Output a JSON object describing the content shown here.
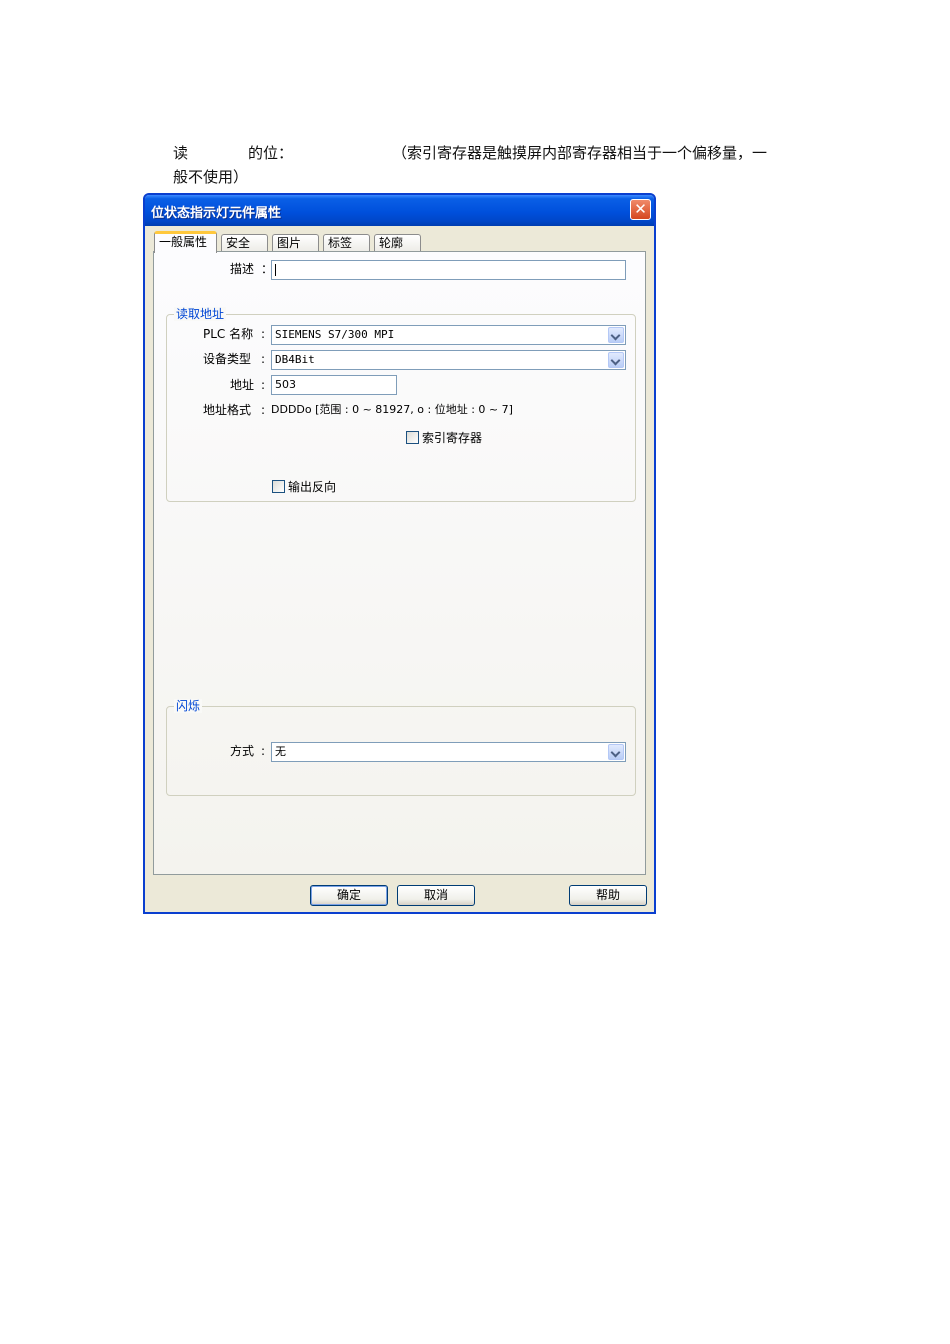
{
  "doc": {
    "line1_word1": "读",
    "line1_word2": "的位：",
    "line1_note": "（索引寄存器是触摸屏内部寄存器相当于一个偏移量，一",
    "line2": "般不使用）"
  },
  "dialog": {
    "title": "位状态指示灯元件属性",
    "close_glyph": "✕",
    "tabs": [
      "一般属性",
      "安全",
      "图片",
      "标签",
      "轮廓"
    ],
    "description": {
      "label": "描述",
      "colon": "：",
      "value": ""
    },
    "read_address": {
      "group_title": "读取地址",
      "plc_label": "PLC 名称",
      "plc_value": "SIEMENS S7/300 MPI",
      "device_type_label": "设备类型",
      "device_type_value": "DB4Bit",
      "address_label": "地址",
      "address_value": "503",
      "format_label": "地址格式",
      "format_value": "DDDDo [范围 : 0 ~ 81927, o : 位地址 : 0 ~ 7]",
      "index_register_label": "索引寄存器",
      "index_register_checked": false,
      "invert_output_label": "输出反向",
      "invert_output_checked": false
    },
    "blink": {
      "group_title": "闪烁",
      "mode_label": "方式",
      "mode_value": "无"
    },
    "buttons": {
      "ok": "确定",
      "cancel": "取消",
      "help": "帮助"
    }
  },
  "colors": {
    "title_bar": "#0050dc",
    "group_title": "#0046d5",
    "active_tab_accent": "#ffc83c",
    "close_button": "#d5461f"
  }
}
